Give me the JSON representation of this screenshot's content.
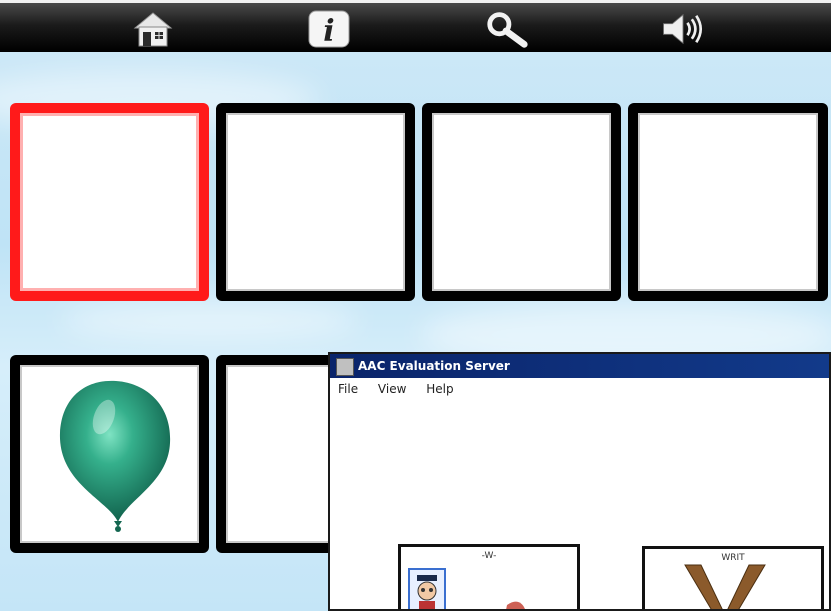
{
  "toolbar": {
    "buttons": [
      {
        "name": "home",
        "icon": "home-icon"
      },
      {
        "name": "info",
        "icon": "info-icon"
      },
      {
        "name": "search",
        "icon": "search-icon"
      },
      {
        "name": "speaker",
        "icon": "speaker-icon"
      }
    ]
  },
  "grid": {
    "selected_border_color": "#ff1a1a",
    "tiles": [
      {
        "id": 1,
        "content": "",
        "selected": true
      },
      {
        "id": 2,
        "content": "",
        "selected": false
      },
      {
        "id": 3,
        "content": "",
        "selected": false
      },
      {
        "id": 4,
        "content": "",
        "selected": false
      },
      {
        "id": 5,
        "content": "balloon-image",
        "balloon_color": "#2a9c7e",
        "selected": false
      },
      {
        "id": 6,
        "content": "",
        "selected": false
      }
    ]
  },
  "overlay_window": {
    "title": "AAC Evaluation Server",
    "menu": [
      "File",
      "View",
      "Help"
    ],
    "cards": [
      {
        "label": "-W-",
        "picture": "person-with-cap"
      },
      {
        "label": "WRIT",
        "picture": "letter-v-shape"
      }
    ]
  }
}
